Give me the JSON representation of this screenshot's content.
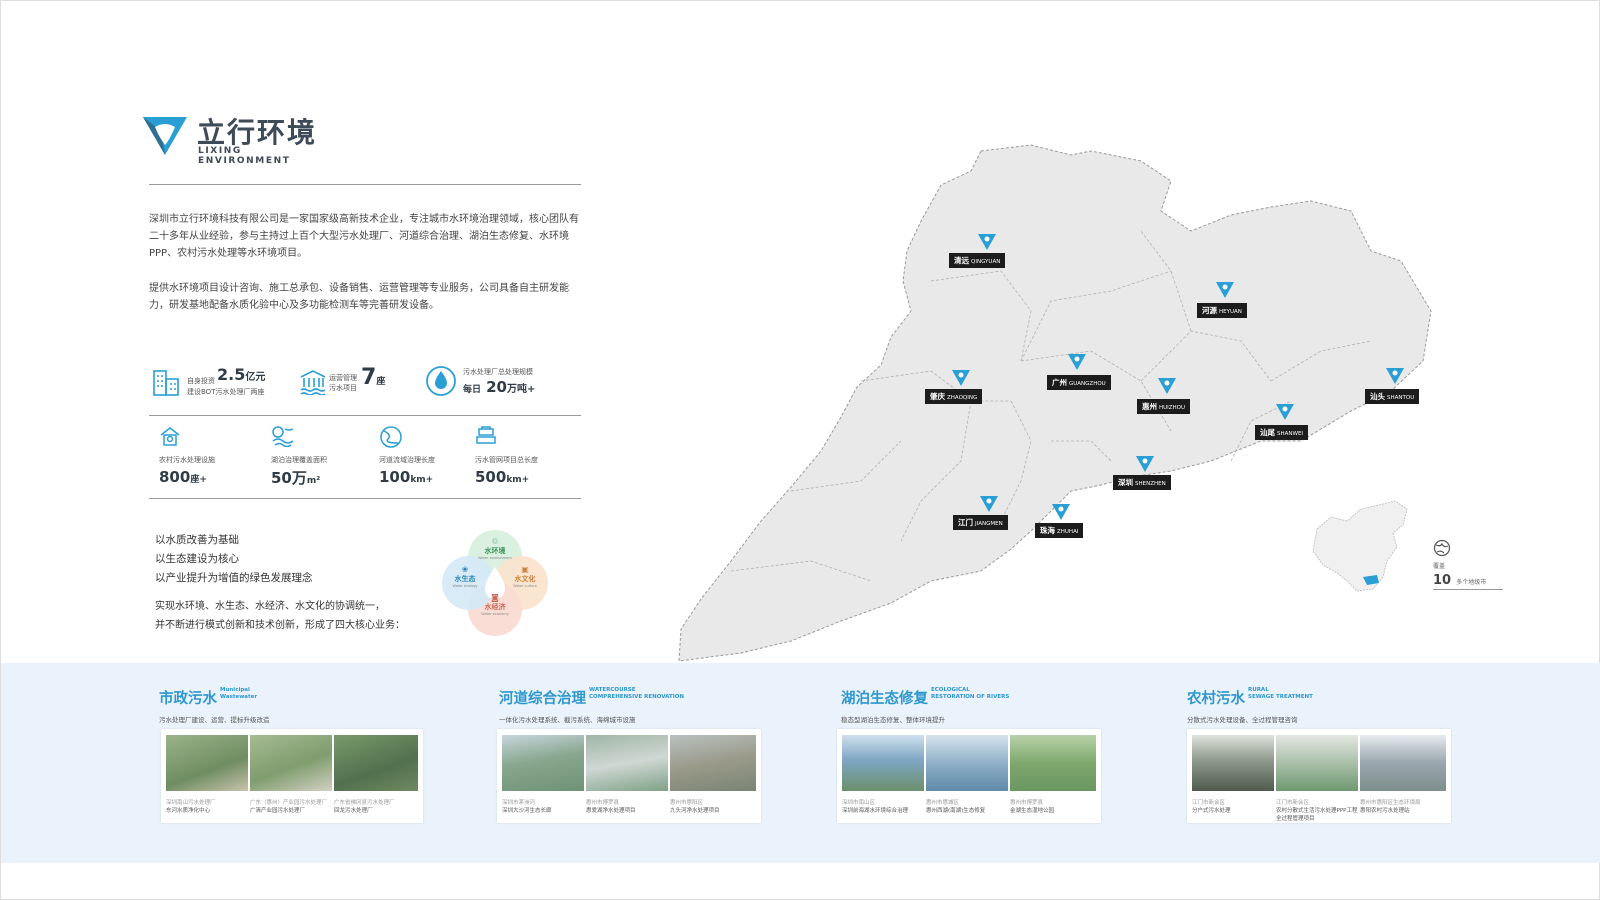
{
  "brand": {
    "name_cn": "立行环境",
    "name_en": "LIXING ENVIRONMENT",
    "logo_color": "#2a9fd6",
    "logo_dark": "#2d6e93"
  },
  "intro": {
    "p1": "深圳市立行环境科技有限公司是一家国家级高新技术企业，专注城市水环境治理领域，核心团队有二十多年从业经验，参与主持过上百个大型污水处理厂、河道综合治理、湖泊生态修复、水环境PPP、农村污水处理等水环境项目。",
    "p2": "提供水环境项目设计咨询、施工总承包、设备销售、运营管理等专业服务，公司具备自主研发能力，研发基地配备水质化验中心及多功能检测车等完善研发设备。"
  },
  "stats": [
    {
      "icon": "building-icon",
      "cap1": "自身投资",
      "cap2": "建设BOT污水处理厂两座",
      "num": "2.5",
      "unit": "亿元"
    },
    {
      "icon": "water-plant-icon",
      "cap1": "运营管理",
      "cap2": "污水项目",
      "num": "7",
      "unit": "座"
    },
    {
      "icon": "water-drop-icon",
      "cap1": "污水处理厂总处理规模",
      "cap2": "每日",
      "num": "20",
      "unit": "万吨+"
    }
  ],
  "metrics": [
    {
      "icon": "house-icon",
      "cap": "农村污水处理设施",
      "num": "800",
      "unit": "座+"
    },
    {
      "icon": "lake-icon",
      "cap": "湖泊治理覆盖面积",
      "num": "50万",
      "unit": "m²"
    },
    {
      "icon": "river-icon",
      "cap": "河道流域治理长度",
      "num": "100",
      "unit": "km+"
    },
    {
      "icon": "pipe-icon",
      "cap": "污水管网项目总长度",
      "num": "500",
      "unit": "km+"
    }
  ],
  "slogans": [
    "以水质改善为基础",
    "以生态建设为核心",
    "以产业提升为增值的绿色发展理念"
  ],
  "mission": [
    "实现水环境、水生态、水经济、水文化的协调统一，",
    "并不断进行模式创新和技术创新，形成了四大核心业务："
  ],
  "petals": [
    {
      "cn": "水环境",
      "en": "Water environment",
      "color": "#c9e9d2"
    },
    {
      "cn": "水文化",
      "en": "Water culture",
      "color": "#f6dcc4"
    },
    {
      "cn": "水经济",
      "en": "Water economy",
      "color": "#f8d5cc"
    },
    {
      "cn": "水生态",
      "en": "Water ecology",
      "color": "#c8e2f2"
    }
  ],
  "cities": [
    {
      "cn": "清远",
      "en": "QINGYUAN"
    },
    {
      "cn": "河源",
      "en": "HEYUAN"
    },
    {
      "cn": "肇庆",
      "en": "ZHAOQING"
    },
    {
      "cn": "广州",
      "en": "GUANGZHOU"
    },
    {
      "cn": "惠州",
      "en": "HUIZHOU"
    },
    {
      "cn": "汕头",
      "en": "SHANTOU"
    },
    {
      "cn": "汕尾",
      "en": "SHANWEI"
    },
    {
      "cn": "深圳",
      "en": "SHENZHEN"
    },
    {
      "cn": "江门",
      "en": "JIANGMEN"
    },
    {
      "cn": "珠海",
      "en": "ZHUHAI"
    }
  ],
  "coverage": {
    "icon": "globe-icon",
    "cap": "覆盖",
    "num": "10",
    "unit": "多个地级市"
  },
  "business": [
    {
      "title": "市政污水",
      "en1": "Municipal",
      "en2": "Wastewater",
      "desc": "污水处理厂建设、运营、提标升级改造",
      "photos": [
        {
          "color": "#7a9a6a",
          "cap1": "深圳南山污水处理厂",
          "cap2": "东河水质净化中心"
        },
        {
          "color": "#8daa77",
          "cap1": "广东（惠州）产业园污水处理厂",
          "cap2": "广清产业园污水处理厂"
        },
        {
          "color": "#5f7f58",
          "cap1": "广东省佛冈县污水处理厂",
          "cap2": "回龙污水处理厂"
        }
      ]
    },
    {
      "title": "河道综合治理",
      "en1": "WATERCOURSE",
      "en2": "COMPREHENSIVE RENOVATION",
      "desc": "一体化污水处理系统、截污系统、海绵城市设施",
      "photos": [
        {
          "color": "#7fa489",
          "cap1": "深圳市茅洲河",
          "cap2": "深圳大沙河生态长廊"
        },
        {
          "color": "#9bb0a2",
          "cap1": "惠州市博罗县",
          "cap2": "惠爱湖净水处理项目"
        },
        {
          "color": "#a8a99e",
          "cap1": "惠州市惠阳区",
          "cap2": "九头河净水处理项目"
        }
      ]
    },
    {
      "title": "湖泊生态修复",
      "en1": "ECOLOGICAL",
      "en2": "RESTORATION OF RIVERS",
      "desc": "稳态型湖泊生态修复、整体环境提升",
      "photos": [
        {
          "color": "#6f9dbf",
          "cap1": "深圳市南山区",
          "cap2": "深圳前海湖水环境综合治理"
        },
        {
          "color": "#7da5c2",
          "cap1": "惠州市惠城区",
          "cap2": "惠州西湖(南湖)生态修复"
        },
        {
          "color": "#7ea66f",
          "cap1": "惠州市博罗县",
          "cap2": "金湖生态湿地公园"
        }
      ]
    },
    {
      "title": "农村污水",
      "en1": "RURAL",
      "en2": "SEWAGE TREATMENT",
      "desc": "分散式污水处理设备、全过程管理咨询",
      "photos": [
        {
          "color": "#6b7b6a",
          "cap1": "江门市新会区",
          "cap2": "分户式污水处理"
        },
        {
          "color": "#9ab19c",
          "cap1": "江门市新会区",
          "cap2": "农村分散式生活污水处理PPP工程全过程管理项目"
        },
        {
          "color": "#8a9aa7",
          "cap1": "惠州市惠阳区生态环境局",
          "cap2": "惠阳农村污水处理站"
        }
      ]
    }
  ]
}
